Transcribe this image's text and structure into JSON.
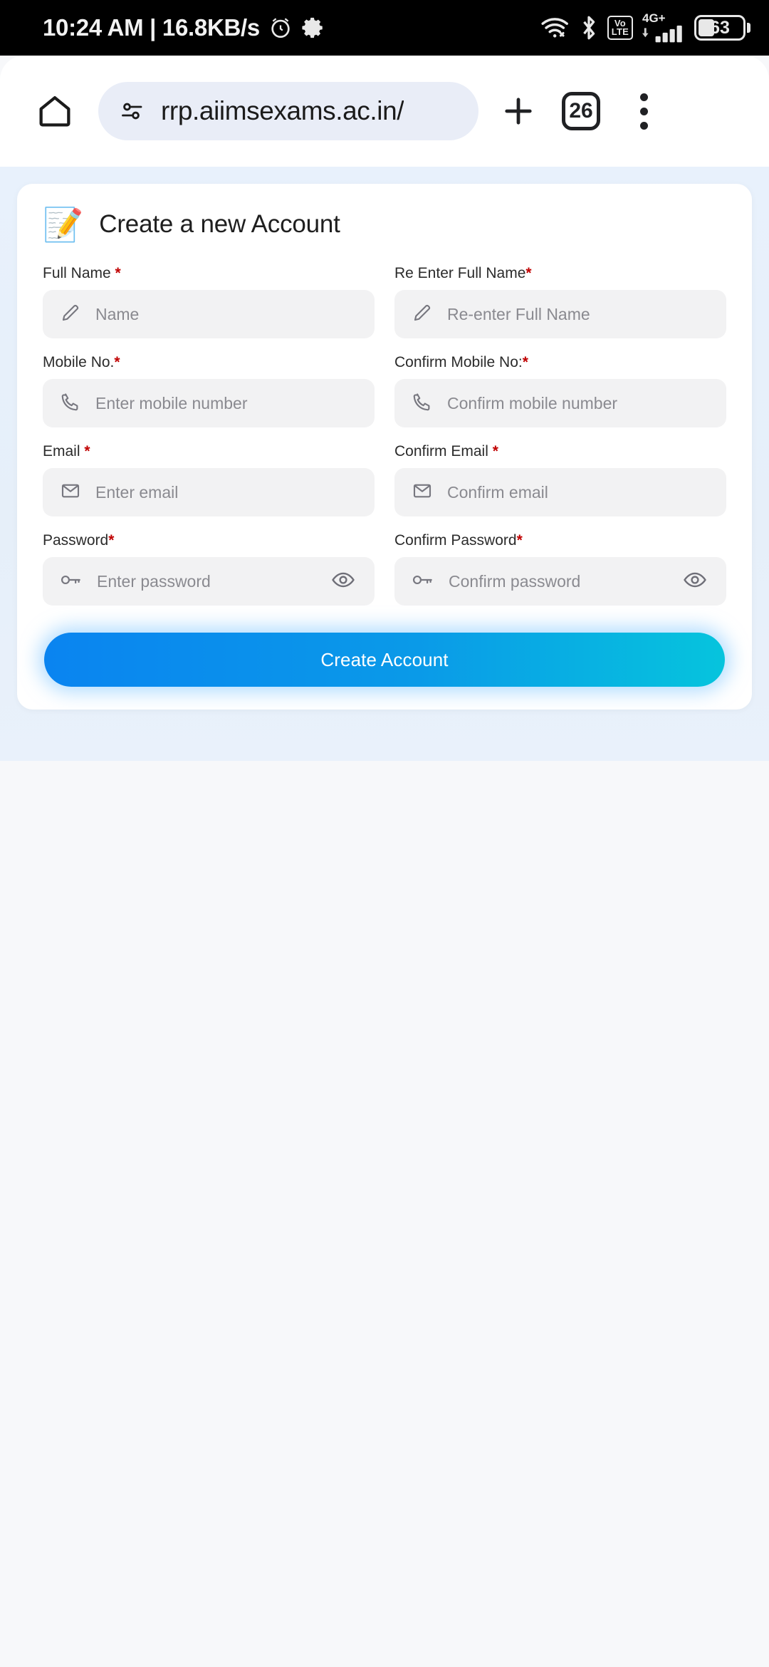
{
  "status_bar": {
    "clock": "10:24 AM | 16.8KB/s",
    "alarm_icon": "alarm-icon",
    "settings_icon": "gear-icon",
    "wifi_icon": "wifi-icon",
    "bluetooth_icon": "bluetooth-icon",
    "volte_top": "Vo",
    "volte_bottom": "LTE",
    "network_type": "4G+",
    "battery_percent": "63"
  },
  "browser": {
    "home_icon": "home-icon",
    "site_settings_icon": "tune-icon",
    "url": "rrp.aiimsexams.ac.in/",
    "new_tab_icon": "plus-icon",
    "tab_count": "26",
    "menu_icon": "more-vertical-icon"
  },
  "form": {
    "emoji": "📝",
    "title": "Create a new Account",
    "submit_label": "Create Account",
    "fields": [
      {
        "label": "Full Name",
        "required_mark": "*",
        "space_before_mark": true,
        "placeholder": "Name",
        "icon": "pencil-icon",
        "name": "full-name",
        "has_eye": false
      },
      {
        "label": "Re Enter Full Name",
        "required_mark": "*",
        "space_before_mark": false,
        "placeholder": "Re-enter Full Name",
        "icon": "pencil-icon",
        "name": "re-enter-full-name",
        "has_eye": false
      },
      {
        "label": "Mobile No.",
        "required_mark": "*",
        "space_before_mark": false,
        "placeholder": "Enter mobile number",
        "icon": "phone-icon",
        "name": "mobile-no",
        "has_eye": false
      },
      {
        "label": "Confirm Mobile No:",
        "required_mark": "*",
        "space_before_mark": false,
        "placeholder": "Confirm mobile number",
        "icon": "phone-icon",
        "name": "confirm-mobile-no",
        "has_eye": false
      },
      {
        "label": "Email",
        "required_mark": "*",
        "space_before_mark": true,
        "placeholder": "Enter email",
        "icon": "envelope-icon",
        "name": "email",
        "has_eye": false
      },
      {
        "label": "Confirm Email",
        "required_mark": "*",
        "space_before_mark": true,
        "placeholder": "Confirm email",
        "icon": "envelope-icon",
        "name": "confirm-email",
        "has_eye": false
      },
      {
        "label": "Password",
        "required_mark": "*",
        "space_before_mark": false,
        "placeholder": "Enter password",
        "icon": "key-icon",
        "name": "password",
        "has_eye": true
      },
      {
        "label": "Confirm Password",
        "required_mark": "*",
        "space_before_mark": false,
        "placeholder": "Confirm password",
        "icon": "key-icon",
        "name": "confirm-password",
        "has_eye": true
      }
    ]
  },
  "colors": {
    "accent_start": "#0a84f0",
    "accent_end": "#06c4dd",
    "required": "#c00000",
    "page_bg": "#e8f1fc",
    "input_bg": "#f2f2f3",
    "url_pill_bg": "#e9edf7"
  }
}
